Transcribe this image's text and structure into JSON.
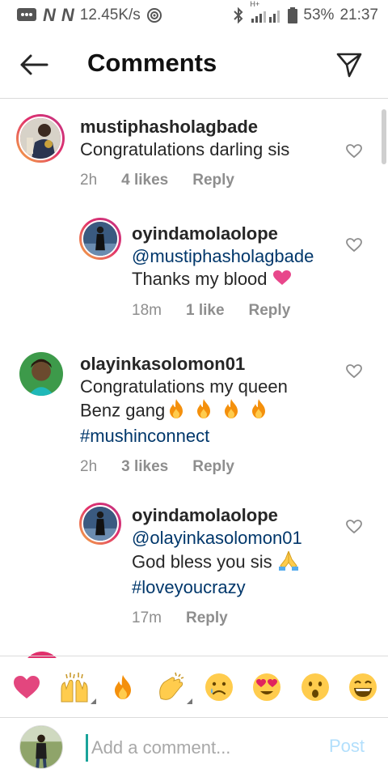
{
  "status_bar": {
    "speed": "12.45K/s",
    "network_icons": [
      "N",
      "N"
    ],
    "battery": "53%",
    "time": "21:37",
    "signal_label": "H+"
  },
  "header": {
    "title": "Comments"
  },
  "comments": [
    {
      "username": "mustiphasholagbade",
      "text": "Congratulations darling sis",
      "time": "2h",
      "likes": "4 likes",
      "reply_label": "Reply"
    },
    {
      "username": "oyindamolaolope",
      "mention": "@mustiphasholagbade",
      "text": "Thanks my blood",
      "emoji": "pink-heart",
      "time": "18m",
      "likes": "1 like",
      "reply_label": "Reply"
    },
    {
      "username": "olayinkasolomon01",
      "text_line1": "Congratulations my queen",
      "text_line2": "Benz gang",
      "emoji": "fire x4",
      "hashtag": "#mushinconnect",
      "time": "2h",
      "likes": "3 likes",
      "reply_label": "Reply"
    },
    {
      "username": "oyindamolaolope",
      "mention": "@olayinkasolomon01",
      "text": "God bless you sis",
      "emoji": "folded-hands",
      "hashtag": "#loveyoucrazy",
      "time": "17m",
      "reply_label": "Reply"
    }
  ],
  "emoji_bar": [
    "heart",
    "raising-hands",
    "fire",
    "clapping-hands",
    "sad-face",
    "heart-eyes",
    "surprised-face",
    "laughing-face"
  ],
  "compose": {
    "placeholder": "Add a comment...",
    "post_label": "Post"
  },
  "colors": {
    "link": "#00376b",
    "post_disabled": "#b2dffc",
    "meta_gray": "#8e8e8e"
  }
}
